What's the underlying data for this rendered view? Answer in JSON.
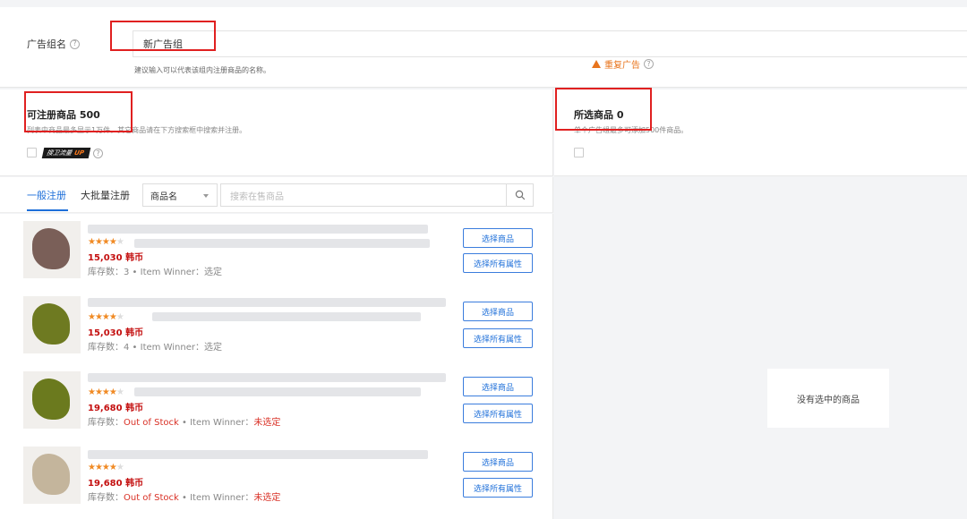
{
  "group_name": {
    "label": "广告组名",
    "value": "新广告组",
    "hint": "建议输入可以代表该组内注册商品的名称。"
  },
  "available": {
    "title": "可注册商品 500",
    "subtitle": "列表中商品最多显示1万件，其它商品请在下方搜索框中搜索并注册。",
    "badge_text": "搜卫流量",
    "badge_up": "UP"
  },
  "selected": {
    "title": "所选商品 0",
    "subtitle": "单个广告组最多可添加500件商品。",
    "repeat_label": "重复广告",
    "empty_text": "没有选中的商品"
  },
  "tabs": {
    "general": "一般注册",
    "bulk": "大批量注册"
  },
  "search": {
    "field_select": "商品名",
    "placeholder": "搜索在售商品"
  },
  "products": [
    {
      "price": "15,030 韩币",
      "stock_label": "库存数：",
      "stock_value": "3",
      "winner_label": "Item Winner：",
      "winner_value": "选定",
      "select_btn": "选择商品",
      "select_all_btn": "选择所有属性",
      "color": "#7a5f58"
    },
    {
      "price": "15,030 韩币",
      "stock_label": "库存数：",
      "stock_value": "4",
      "winner_label": "Item Winner：",
      "winner_value": "选定",
      "select_btn": "选择商品",
      "select_all_btn": "选择所有属性",
      "color": "#6e7a21"
    },
    {
      "price": "19,680 韩币",
      "stock_label": "库存数：",
      "stock_value": "Out of Stock",
      "winner_label": "Item Winner：",
      "winner_value": "未选定",
      "select_btn": "选择商品",
      "select_all_btn": "选择所有属性",
      "color": "#6b7a1e"
    },
    {
      "price": "19,680 韩币",
      "stock_label": "库存数：",
      "stock_value": "Out of Stock",
      "winner_label": "Item Winner：",
      "winner_value": "未选定",
      "select_btn": "选择商品",
      "select_all_btn": "选择所有属性",
      "color": "#c4b59c"
    }
  ]
}
